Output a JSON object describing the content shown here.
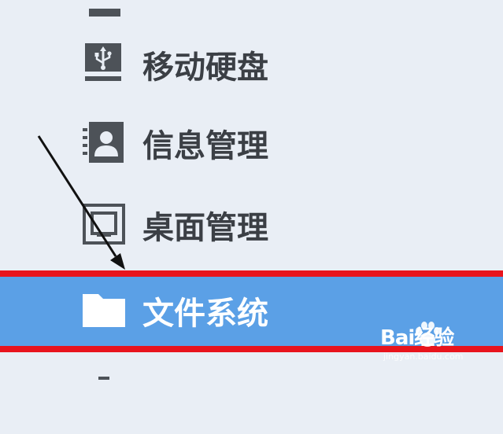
{
  "sidebar": {
    "items": [
      {
        "label": "",
        "icon": "partial-item-icon",
        "selected": false
      },
      {
        "label": "移动硬盘",
        "icon": "usb-drive-icon",
        "selected": false
      },
      {
        "label": "信息管理",
        "icon": "contact-card-icon",
        "selected": false
      },
      {
        "label": "桌面管理",
        "icon": "desktop-icon",
        "selected": false
      },
      {
        "label": "文件系统",
        "icon": "folder-icon",
        "selected": true
      },
      {
        "label": "",
        "icon": "partial-item-icon",
        "selected": false
      }
    ]
  },
  "colors": {
    "background": "#e9eef5",
    "selected_background": "#5ba0e6",
    "highlight_line": "#e8141d",
    "text": "#3b3f45",
    "icon": "#4d5258"
  },
  "watermark": {
    "main": "Bai经验",
    "sub": "jingyan.baidu.com"
  }
}
